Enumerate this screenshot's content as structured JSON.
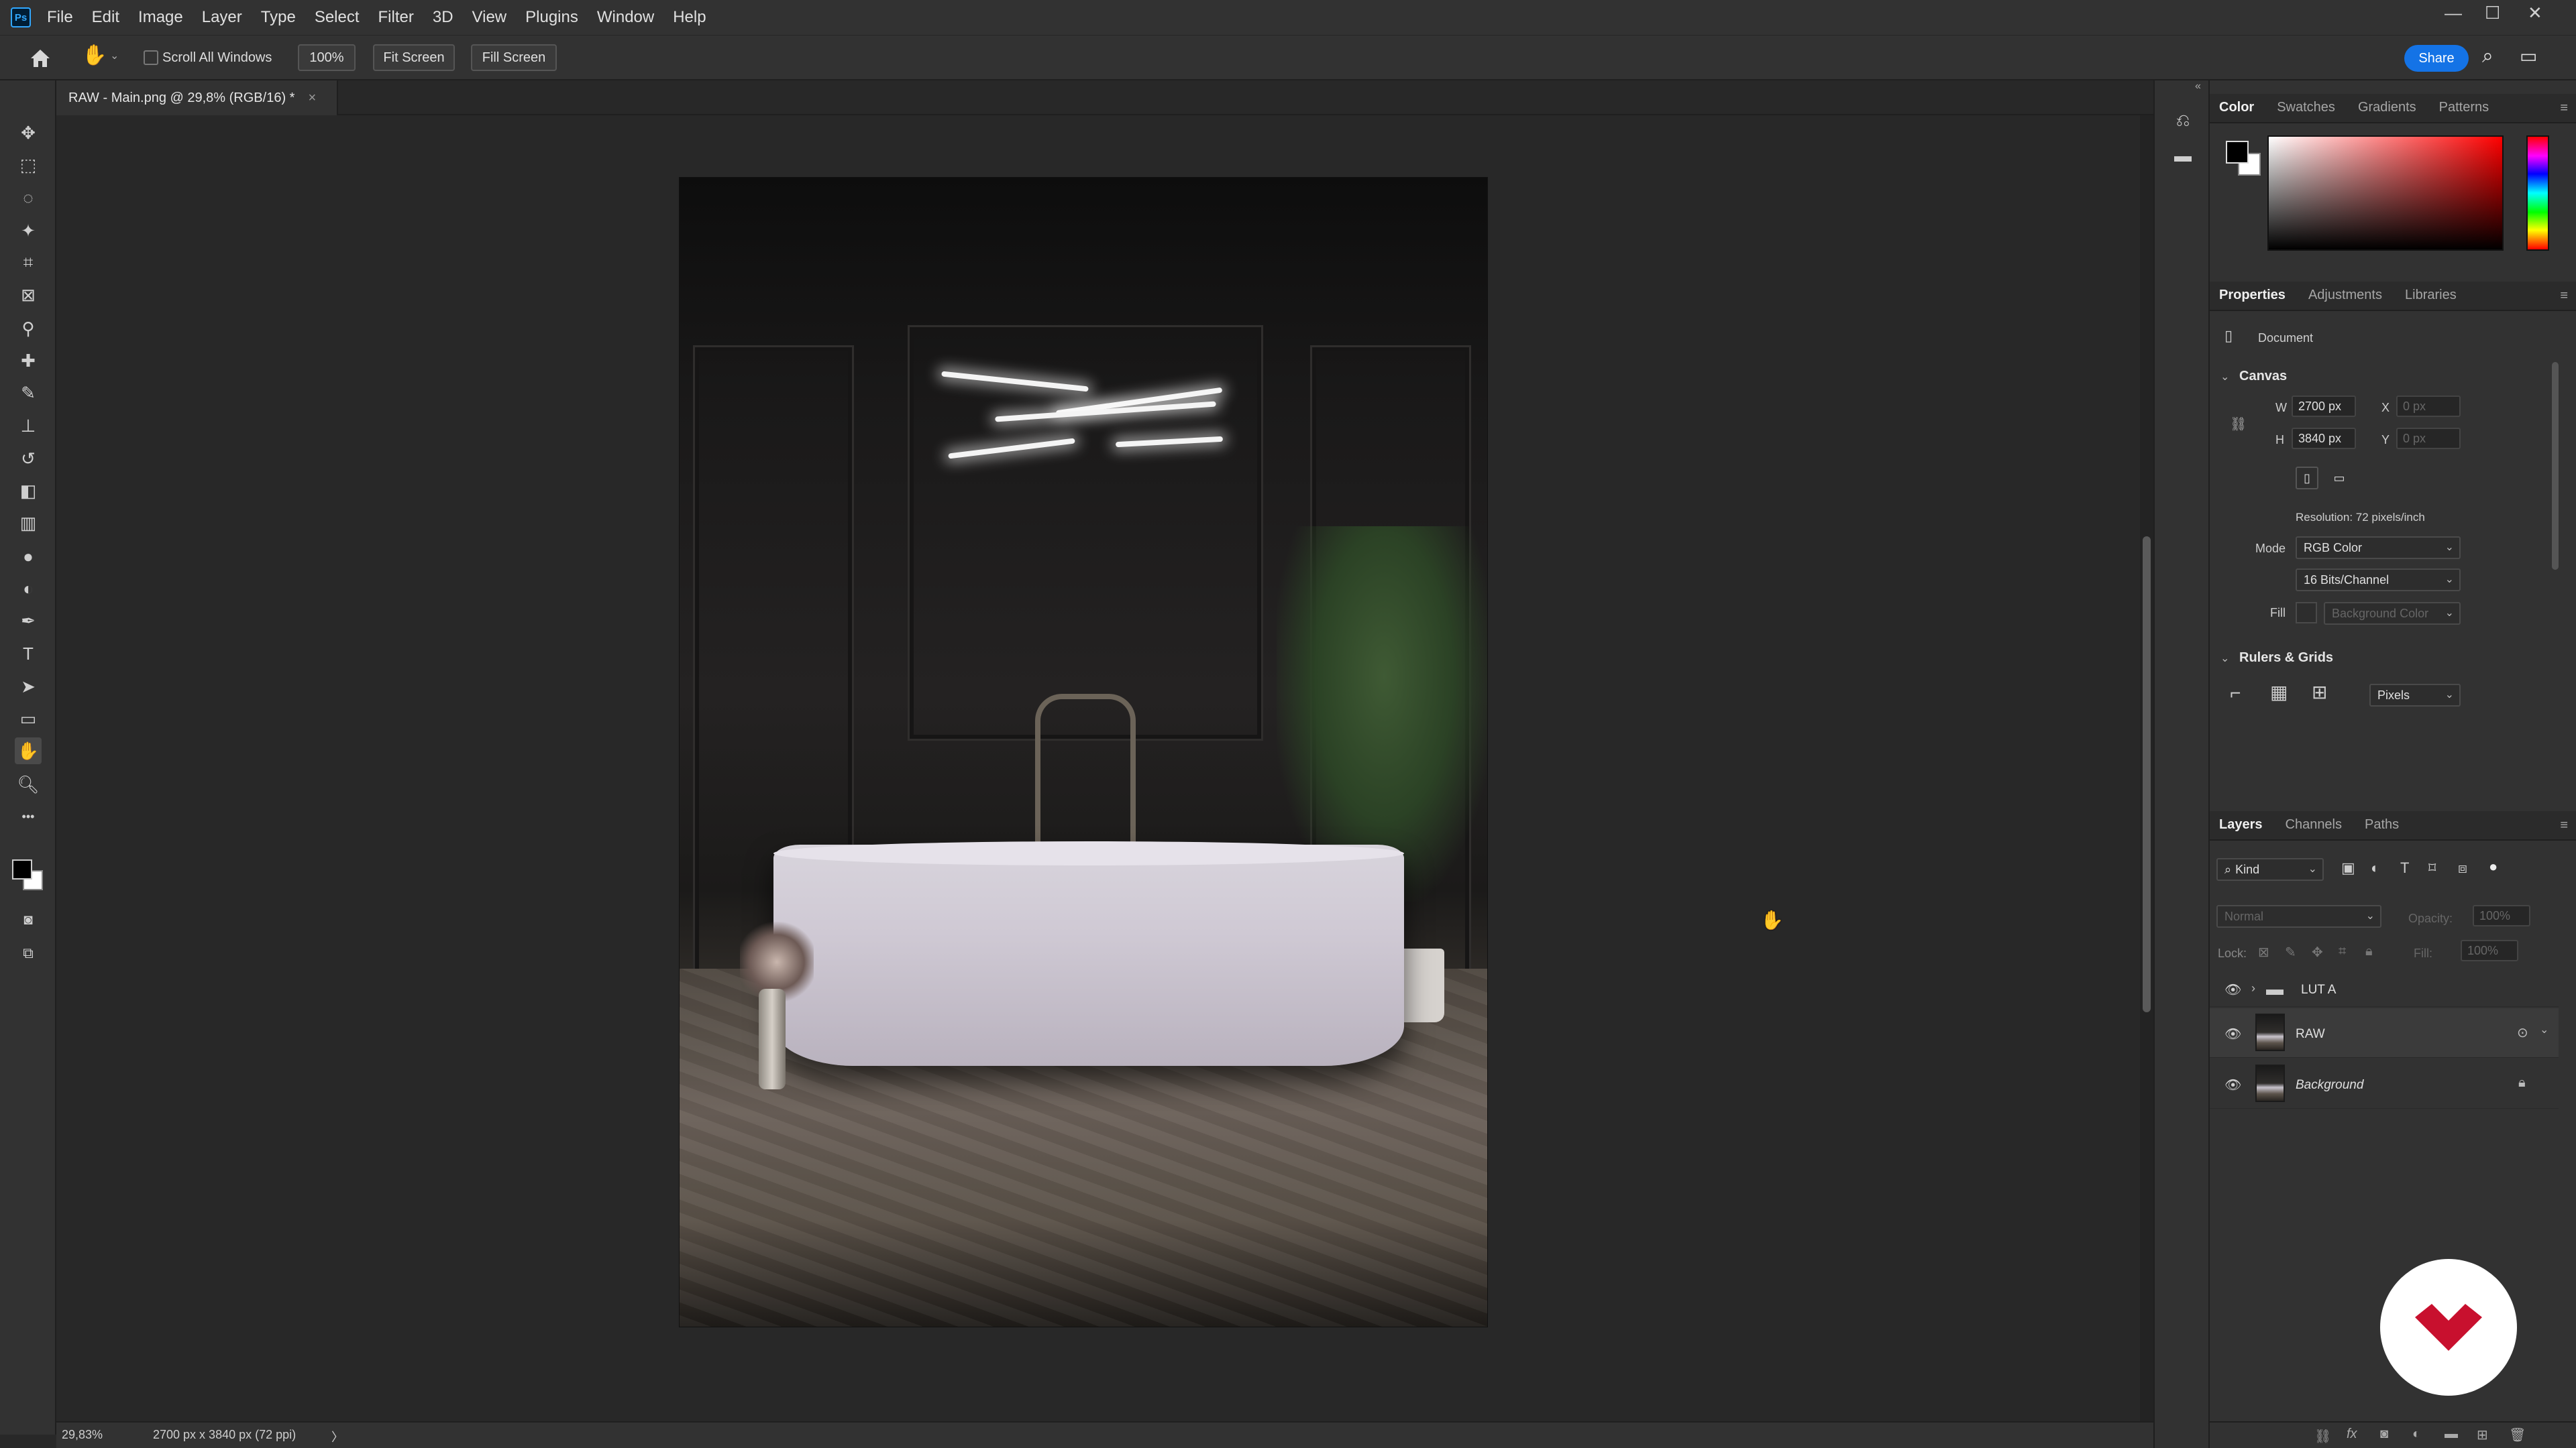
{
  "app": {
    "logo_text": "Ps",
    "menu": [
      "File",
      "Edit",
      "Image",
      "Layer",
      "Type",
      "Select",
      "Filter",
      "3D",
      "View",
      "Plugins",
      "Window",
      "Help"
    ],
    "window_controls": {
      "minimize": "—",
      "maximize": "☐",
      "close": "✕"
    }
  },
  "options_bar": {
    "home_icon": "home-icon",
    "tool_icon": "hand-tool-icon",
    "scroll_all_windows_label": "Scroll All Windows",
    "scroll_all_windows_checked": false,
    "zoom_100_label": "100%",
    "fit_screen_label": "Fit Screen",
    "fill_screen_label": "Fill Screen",
    "share_label": "Share"
  },
  "document": {
    "tab_title": "RAW - Main.png @ 29,8% (RGB/16) *",
    "close_glyph": "×"
  },
  "status_bar": {
    "zoom": "29,83%",
    "doc_info": "2700 px x 3840 px (72 ppi)",
    "arrow": "〉"
  },
  "toolbar": {
    "tools": [
      {
        "name": "move-tool-icon",
        "glyph": "✥"
      },
      {
        "name": "rectangular-marquee-icon",
        "glyph": "⬚"
      },
      {
        "name": "lasso-icon",
        "glyph": "◌"
      },
      {
        "name": "magic-wand-icon",
        "glyph": "✦"
      },
      {
        "name": "crop-icon",
        "glyph": "⌗"
      },
      {
        "name": "frame-icon",
        "glyph": "⊠"
      },
      {
        "name": "eyedropper-icon",
        "glyph": "⚲"
      },
      {
        "name": "healing-brush-icon",
        "glyph": "✚"
      },
      {
        "name": "brush-icon",
        "glyph": "✎"
      },
      {
        "name": "clone-stamp-icon",
        "glyph": "⊥"
      },
      {
        "name": "history-brush-icon",
        "glyph": "↺"
      },
      {
        "name": "eraser-icon",
        "glyph": "◧"
      },
      {
        "name": "gradient-icon",
        "glyph": "▥"
      },
      {
        "name": "blur-icon",
        "glyph": "●"
      },
      {
        "name": "dodge-icon",
        "glyph": "◐"
      },
      {
        "name": "pen-icon",
        "glyph": "✒"
      },
      {
        "name": "type-icon",
        "glyph": "T"
      },
      {
        "name": "path-selection-icon",
        "glyph": "➤"
      },
      {
        "name": "rectangle-shape-icon",
        "glyph": "▭"
      },
      {
        "name": "hand-tool-icon",
        "glyph": "✋"
      },
      {
        "name": "zoom-icon",
        "glyph": "🔍︎"
      },
      {
        "name": "more-tools-icon",
        "glyph": "•••"
      }
    ]
  },
  "color_panel": {
    "tabs": [
      "Color",
      "Swatches",
      "Gradients",
      "Patterns"
    ],
    "foreground": "#000000",
    "background": "#ffffff"
  },
  "properties_panel": {
    "tabs": [
      "Properties",
      "Adjustments",
      "Libraries"
    ],
    "doc_label": "Document",
    "canvas_title": "Canvas",
    "w_label": "W",
    "w_value": "2700 px",
    "h_label": "H",
    "h_value": "3840 px",
    "x_label": "X",
    "x_value": "0 px",
    "y_label": "Y",
    "y_value": "0 px",
    "resolution": "Resolution: 72 pixels/inch",
    "mode_label": "Mode",
    "mode_value": "RGB Color",
    "bits_value": "16 Bits/Channel",
    "fill_label": "Fill",
    "fill_value": "Background Color",
    "rulers_title": "Rulers & Grids",
    "units_value": "Pixels"
  },
  "layers_panel": {
    "tabs": [
      "Layers",
      "Channels",
      "Paths"
    ],
    "filter_value": "Kind",
    "blend_mode": "Normal",
    "opacity_label": "Opacity:",
    "opacity_value": "100%",
    "lock_label": "Lock:",
    "fill_label": "Fill:",
    "fill_value": "100%",
    "layers": [
      {
        "name": "LUT A",
        "type": "group"
      },
      {
        "name": "RAW",
        "type": "smart"
      },
      {
        "name": "Background",
        "type": "background"
      }
    ]
  }
}
